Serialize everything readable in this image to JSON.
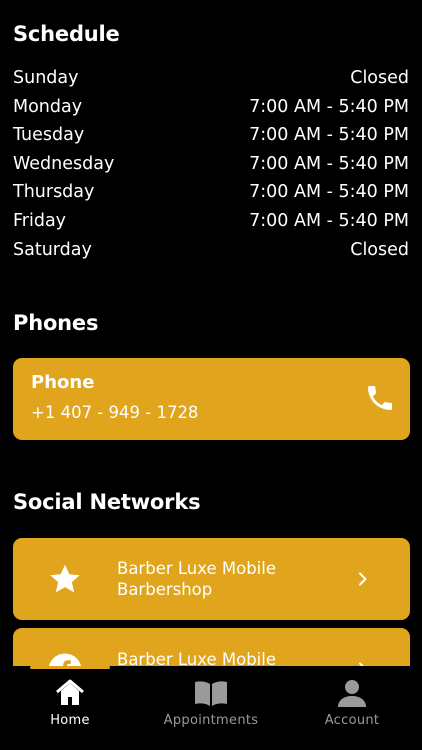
{
  "schedule": {
    "title": "Schedule",
    "days": [
      {
        "day": "Sunday",
        "hours": "Closed"
      },
      {
        "day": "Monday",
        "hours": "7:00 AM - 5:40 PM"
      },
      {
        "day": "Tuesday",
        "hours": "7:00 AM - 5:40 PM"
      },
      {
        "day": "Wednesday",
        "hours": "7:00 AM - 5:40 PM"
      },
      {
        "day": "Thursday",
        "hours": "7:00 AM - 5:40 PM"
      },
      {
        "day": "Friday",
        "hours": "7:00 AM - 5:40 PM"
      },
      {
        "day": "Saturday",
        "hours": "Closed"
      }
    ]
  },
  "phones": {
    "title": "Phones",
    "items": [
      {
        "label": "Phone",
        "number": "+1 407 - 949 - 1728",
        "icon": "phone-icon"
      }
    ]
  },
  "social": {
    "title": "Social Networks",
    "items": [
      {
        "label": "Barber Luxe Mobile Barbershop",
        "icon": "star-icon"
      },
      {
        "label": "Barber Luxe Mobile",
        "icon": "facebook-icon"
      }
    ]
  },
  "tabbar": {
    "items": [
      {
        "label": "Home",
        "icon": "home-icon",
        "active": true
      },
      {
        "label": "Appointments",
        "icon": "book-icon",
        "active": false
      },
      {
        "label": "Account",
        "icon": "person-icon",
        "active": false
      }
    ]
  },
  "colors": {
    "accent": "#e0a41d",
    "background": "#000000",
    "inactive_tab": "#9a9a9a"
  }
}
